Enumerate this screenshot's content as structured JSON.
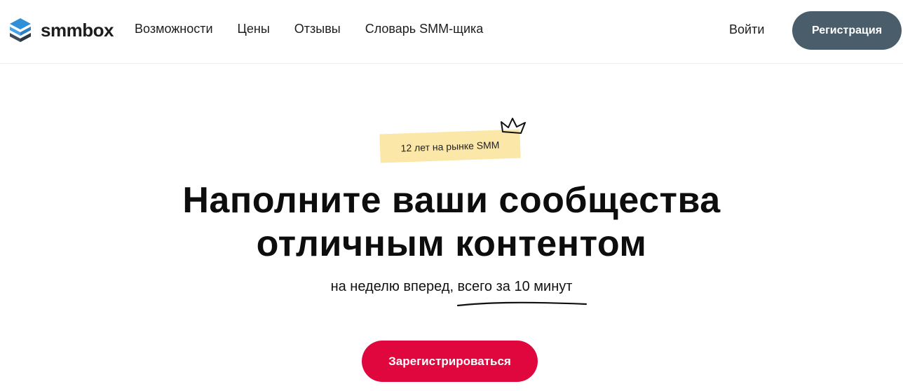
{
  "header": {
    "logo_text": "smmbox",
    "nav": [
      {
        "label": "Возможности"
      },
      {
        "label": "Цены"
      },
      {
        "label": "Отзывы"
      },
      {
        "label": "Словарь SMM-щика"
      }
    ],
    "login_label": "Войти",
    "register_label": "Регистрация"
  },
  "hero": {
    "badge_text": "12 лет на рынке SMM",
    "title_line1": "Наполните ваши сообщества",
    "title_line2": "отличным контентом",
    "subtitle": "на неделю вперед, всего за 10 минут",
    "cta_label": "Зарегистрироваться"
  },
  "icons": {
    "logo": "layers-stack-icon",
    "badge": "crown-icon",
    "subtitle_decoration": "hand-drawn-underline"
  },
  "colors": {
    "register_button": "#4a5d6b",
    "cta_button": "#e0063e",
    "badge_background": "#fbe7a8",
    "logo_blue": "#2f8fd8",
    "logo_dark": "#3d4c58"
  }
}
